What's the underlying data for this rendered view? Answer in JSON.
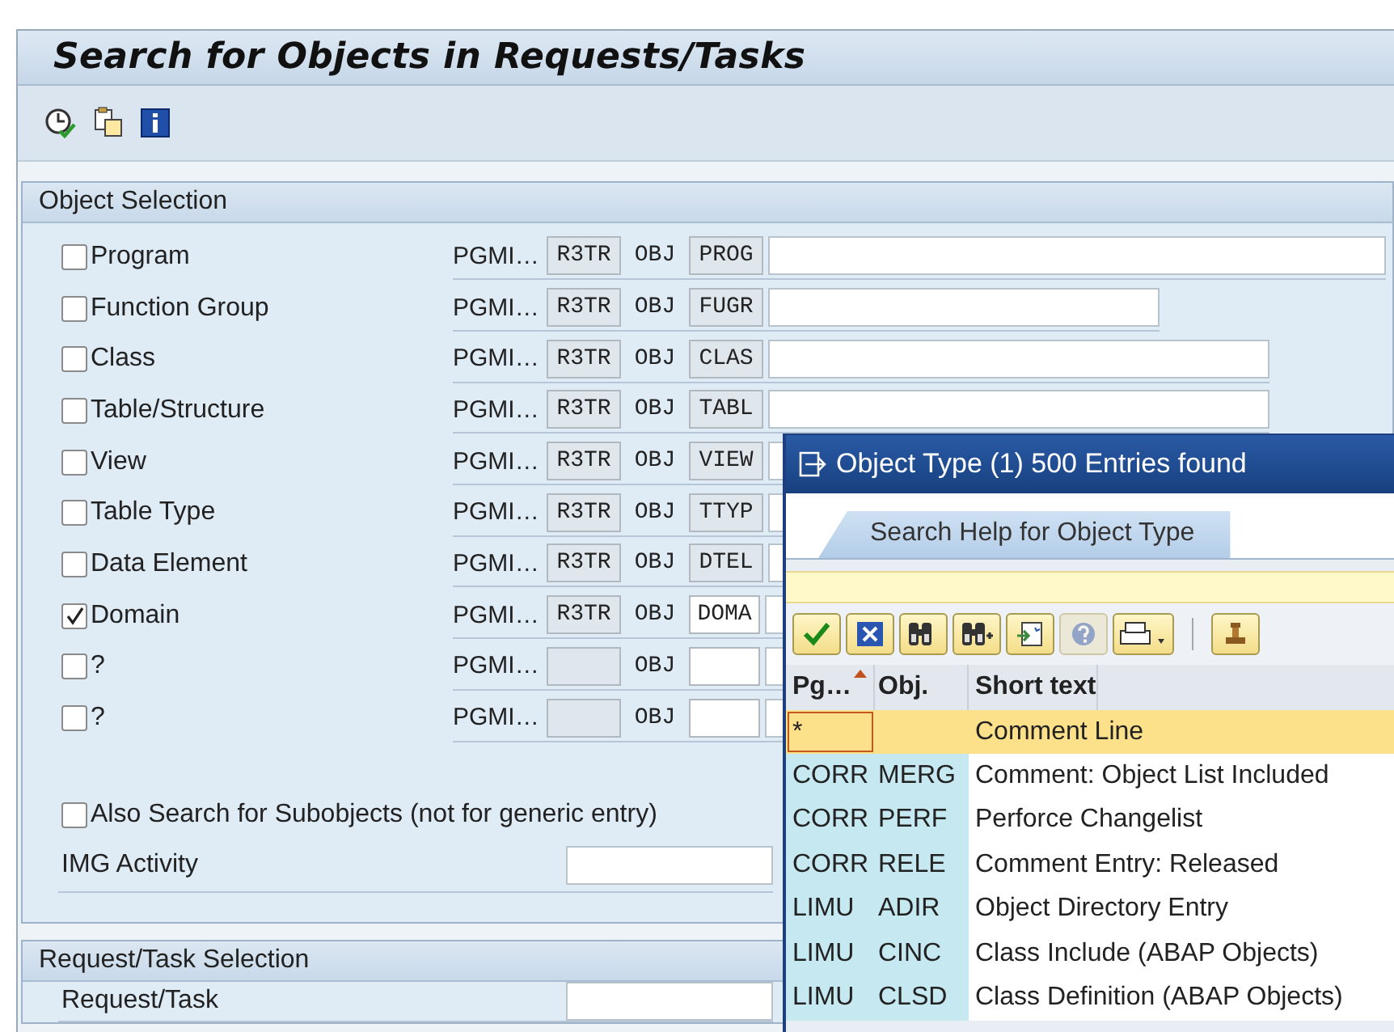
{
  "window": {
    "title": "Search for Objects in Requests/Tasks"
  },
  "toolbar": [
    {
      "kind": "execute"
    },
    {
      "kind": "copy"
    },
    {
      "kind": "info"
    }
  ],
  "object_selection": {
    "title": "Object Selection",
    "rows": [
      {
        "label": "Program",
        "checked": false,
        "pgmid": "PGMI…",
        "r3tr": "R3TR",
        "obj": "OBJ",
        "type": "PROG",
        "type_editable": false
      },
      {
        "label": "Function Group",
        "checked": false,
        "pgmid": "PGMI…",
        "r3tr": "R3TR",
        "obj": "OBJ",
        "type": "FUGR",
        "type_editable": false
      },
      {
        "label": "Class",
        "checked": false,
        "pgmid": "PGMI…",
        "r3tr": "R3TR",
        "obj": "OBJ",
        "type": "CLAS",
        "type_editable": false
      },
      {
        "label": "Table/Structure",
        "checked": false,
        "pgmid": "PGMI…",
        "r3tr": "R3TR",
        "obj": "OBJ",
        "type": "TABL",
        "type_editable": false
      },
      {
        "label": "View",
        "checked": false,
        "pgmid": "PGMI…",
        "r3tr": "R3TR",
        "obj": "OBJ",
        "type": "VIEW",
        "type_editable": false
      },
      {
        "label": "Table Type",
        "checked": false,
        "pgmid": "PGMI…",
        "r3tr": "R3TR",
        "obj": "OBJ",
        "type": "TTYP",
        "type_editable": false
      },
      {
        "label": "Data Element",
        "checked": false,
        "pgmid": "PGMI…",
        "r3tr": "R3TR",
        "obj": "OBJ",
        "type": "DTEL",
        "type_editable": false
      },
      {
        "label": "Domain",
        "checked": true,
        "pgmid": "PGMI…",
        "r3tr": "R3TR",
        "obj": "OBJ",
        "type": "DOMA",
        "type_editable": true
      },
      {
        "label": "?",
        "checked": false,
        "pgmid": "PGMI…",
        "obj": "OBJ",
        "type_editable": true
      },
      {
        "label": "?",
        "checked": false,
        "pgmid": "PGMI…",
        "obj": "OBJ",
        "type_editable": true
      }
    ],
    "subobjects": {
      "label": "Also Search for Subobjects (not for generic entry)",
      "checked": false
    },
    "img_activity": {
      "label": "IMG Activity"
    }
  },
  "request_selection": {
    "title": "Request/Task Selection",
    "field_label": "Request/Task"
  },
  "popup": {
    "title": "Object Type (1)  500 Entries found",
    "tabs": [
      {
        "label": "Search Help for Object Type",
        "selected": true
      }
    ],
    "toolbar": [
      {
        "kind": "check",
        "disabled": false
      },
      {
        "kind": "cancel",
        "disabled": false
      },
      {
        "kind": "find",
        "disabled": false
      },
      {
        "kind": "find-next",
        "disabled": false
      },
      {
        "kind": "export",
        "disabled": false
      },
      {
        "kind": "help",
        "disabled": true
      },
      {
        "kind": "print",
        "disabled": false
      },
      {
        "kind": "separator"
      },
      {
        "kind": "pin",
        "disabled": false
      }
    ],
    "columns": [
      "Pg…",
      "Obj.",
      "Short text"
    ],
    "rows": [
      {
        "pg": "*",
        "text": "Comment Line",
        "selected": true
      },
      {
        "pg": "CORR",
        "obj": "MERG",
        "text": "Comment: Object List Included",
        "selected": false
      },
      {
        "pg": "CORR",
        "obj": "PERF",
        "text": "Perforce Changelist",
        "selected": false
      },
      {
        "pg": "CORR",
        "obj": "RELE",
        "text": "Comment Entry: Released",
        "selected": false
      },
      {
        "pg": "LIMU",
        "obj": "ADIR",
        "text": "Object Directory Entry",
        "selected": false
      },
      {
        "pg": "LIMU",
        "obj": "CINC",
        "text": "Class Include (ABAP Objects)",
        "selected": false
      },
      {
        "pg": "LIMU",
        "obj": "CLSD",
        "text": "Class Definition (ABAP Objects)",
        "selected": false
      }
    ]
  }
}
